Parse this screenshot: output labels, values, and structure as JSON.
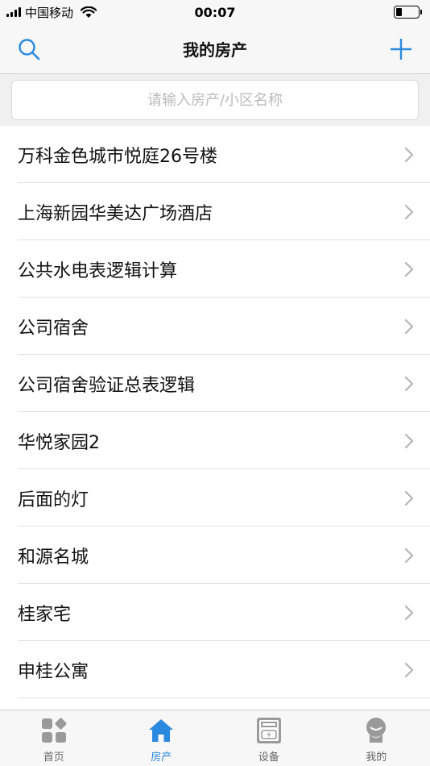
{
  "status_bar": {
    "carrier": "中国移动",
    "time": "00:07",
    "battery_level": 0.25
  },
  "nav": {
    "title": "我的房产",
    "search_icon": "search-icon",
    "add_icon": "plus-icon"
  },
  "search": {
    "placeholder": "请输入房产/小区名称",
    "value": ""
  },
  "properties": [
    {
      "label": "万科金色城市悦庭26号楼"
    },
    {
      "label": "上海新园华美达广场酒店"
    },
    {
      "label": "公共水电表逻辑计算"
    },
    {
      "label": "公司宿舍"
    },
    {
      "label": "公司宿舍验证总表逻辑"
    },
    {
      "label": "华悦家园2"
    },
    {
      "label": "后面的灯"
    },
    {
      "label": "和源名城"
    },
    {
      "label": "桂家宅"
    },
    {
      "label": "申桂公寓"
    }
  ],
  "tabs": [
    {
      "label": "首页",
      "icon": "grid-icon",
      "active": false
    },
    {
      "label": "房产",
      "icon": "home-icon",
      "active": true
    },
    {
      "label": "设备",
      "icon": "meter-icon",
      "active": false
    },
    {
      "label": "我的",
      "icon": "profile-icon",
      "active": false
    }
  ],
  "colors": {
    "accent": "#2a8ae0",
    "inactive": "#9a9a9a"
  }
}
